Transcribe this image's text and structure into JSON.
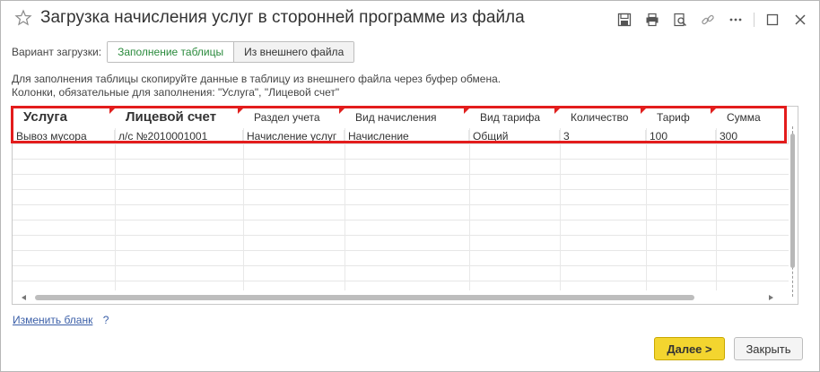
{
  "window": {
    "title": "Загрузка начисления услуг в сторонней программе из файла"
  },
  "toolbar_icons": [
    "save-icon",
    "print-icon",
    "preview-icon",
    "link-icon",
    "more-icon",
    "maximize-icon",
    "close-icon"
  ],
  "variant": {
    "label": "Вариант загрузки:",
    "options": [
      {
        "label": "Заполнение таблицы",
        "active": true
      },
      {
        "label": "Из внешнего файла",
        "active": false
      }
    ]
  },
  "hint": {
    "line1": "Для заполнения таблицы скопируйте данные в таблицу из внешнего файла через буфер обмена.",
    "line2": "Колонки, обязательные для заполнения: \"Услуга\", \"Лицевой счет\""
  },
  "table": {
    "columns": [
      {
        "label": "Услуга",
        "bold": true
      },
      {
        "label": "Лицевой счет",
        "bold": true
      },
      {
        "label": "Раздел  учета",
        "bold": false
      },
      {
        "label": "Вид начисления",
        "bold": false
      },
      {
        "label": "Вид тарифа",
        "bold": false
      },
      {
        "label": "Количество",
        "bold": false
      },
      {
        "label": "Тариф",
        "bold": false
      },
      {
        "label": "Сумма",
        "bold": false
      }
    ],
    "rows": [
      [
        "Вывоз мусора",
        "л/с №2010001001",
        "Начисление услуг",
        "Начисление",
        "Общий",
        "3",
        "100",
        "300"
      ]
    ]
  },
  "links": {
    "change_form": "Изменить бланк",
    "help": "?"
  },
  "buttons": {
    "next": "Далее >",
    "close": "Закрыть"
  },
  "colors": {
    "accent_green": "#2a8a3c",
    "highlight_red": "#e31c1c",
    "primary_button": "#f3d52f",
    "link": "#3b5fa8"
  }
}
